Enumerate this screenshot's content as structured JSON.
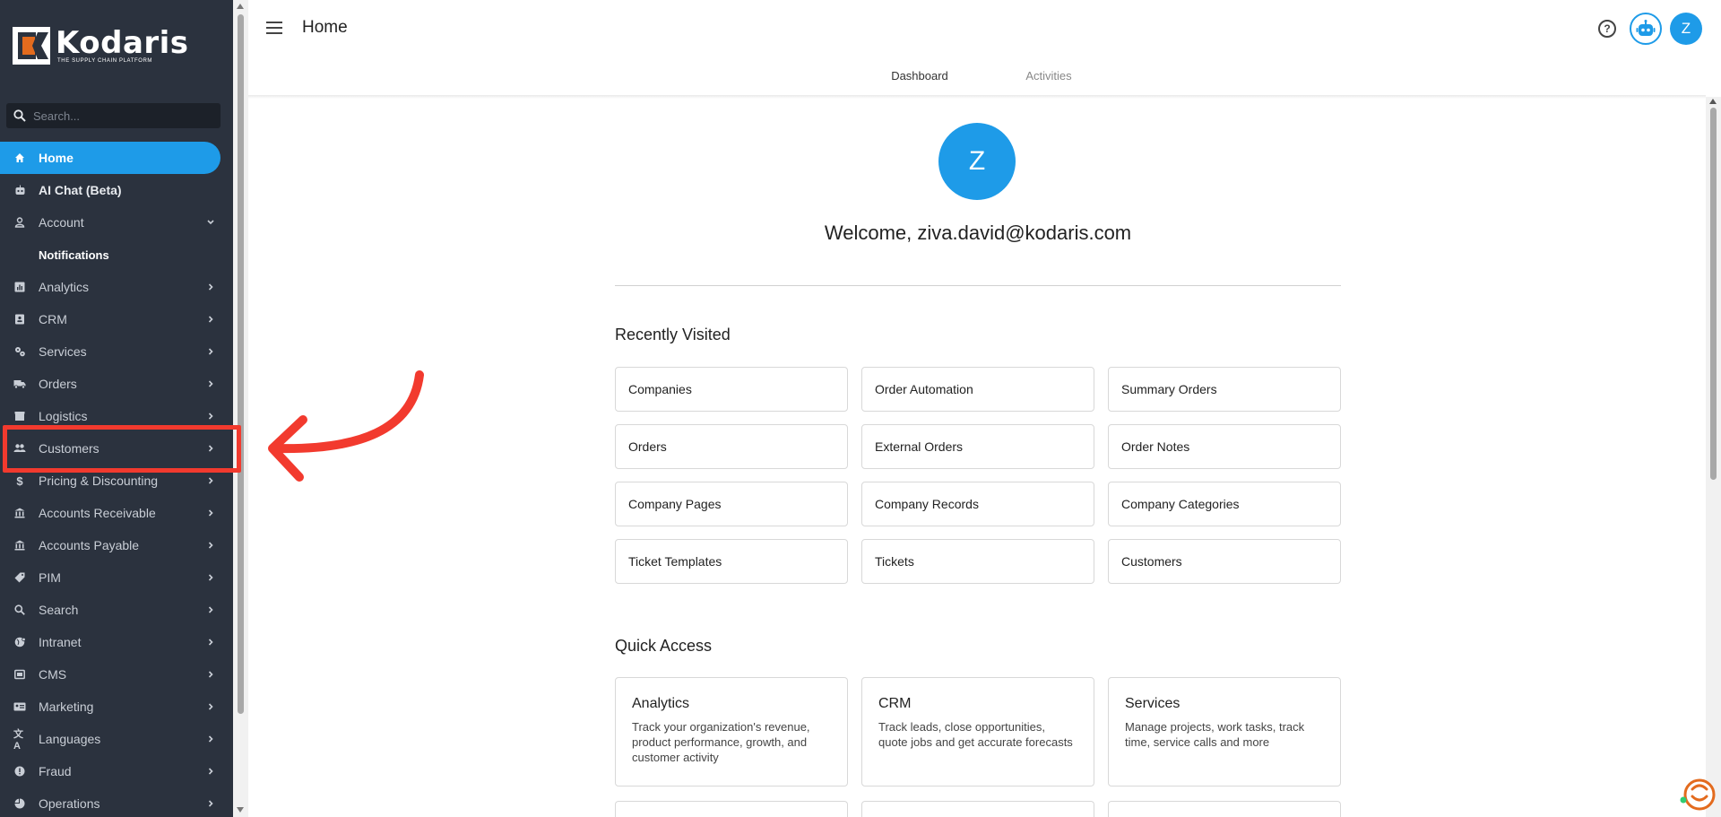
{
  "sidebar": {
    "logo": {
      "name": "Kodaris",
      "tagline": "THE SUPPLY CHAIN PLATFORM"
    },
    "search_placeholder": "Search...",
    "items": [
      {
        "label": "Home",
        "icon": "home-icon",
        "active": true
      },
      {
        "label": "AI Chat (Beta)",
        "icon": "robot-icon"
      },
      {
        "label": "Account",
        "icon": "person-icon",
        "expanded": true
      },
      {
        "label": "Notifications",
        "sub": true
      },
      {
        "label": "Analytics",
        "icon": "chart-icon"
      },
      {
        "label": "CRM",
        "icon": "contact-card-icon"
      },
      {
        "label": "Services",
        "icon": "gears-icon"
      },
      {
        "label": "Orders",
        "icon": "truck-icon"
      },
      {
        "label": "Logistics",
        "icon": "box-icon"
      },
      {
        "label": "Customers",
        "icon": "people-icon"
      },
      {
        "label": "Pricing & Discounting",
        "icon": "dollar-icon"
      },
      {
        "label": "Accounts Receivable",
        "icon": "bank-icon"
      },
      {
        "label": "Accounts Payable",
        "icon": "bank-icon"
      },
      {
        "label": "PIM",
        "icon": "tag-icon"
      },
      {
        "label": "Search",
        "icon": "search-icon"
      },
      {
        "label": "Intranet",
        "icon": "globe-icon"
      },
      {
        "label": "CMS",
        "icon": "window-icon"
      },
      {
        "label": "Marketing",
        "icon": "id-card-icon"
      },
      {
        "label": "Languages",
        "icon": "translate-icon"
      },
      {
        "label": "Fraud",
        "icon": "alert-icon"
      },
      {
        "label": "Operations",
        "icon": "pie-icon"
      }
    ]
  },
  "header": {
    "title": "Home"
  },
  "tabs": [
    {
      "label": "Dashboard",
      "active": true
    },
    {
      "label": "Activities",
      "active": false
    }
  ],
  "user": {
    "initial": "Z",
    "welcome": "Welcome, ziva.david@kodaris.com"
  },
  "recently_visited": {
    "title": "Recently Visited",
    "items": [
      "Companies",
      "Order Automation",
      "Summary Orders",
      "Orders",
      "External Orders",
      "Order Notes",
      "Company Pages",
      "Company Records",
      "Company Categories",
      "Ticket Templates",
      "Tickets",
      "Customers"
    ]
  },
  "quick_access": {
    "title": "Quick Access",
    "items": [
      {
        "title": "Analytics",
        "desc": "Track your organization's revenue, product performance, growth, and customer activity"
      },
      {
        "title": "CRM",
        "desc": "Track leads, close opportunities, quote jobs and get accurate forecasts"
      },
      {
        "title": "Services",
        "desc": "Manage projects, work tasks, track time, service calls and more"
      }
    ]
  },
  "colors": {
    "sidebar_bg": "#2b323e",
    "accent": "#1e9be8",
    "highlight": "#f23a2e"
  }
}
